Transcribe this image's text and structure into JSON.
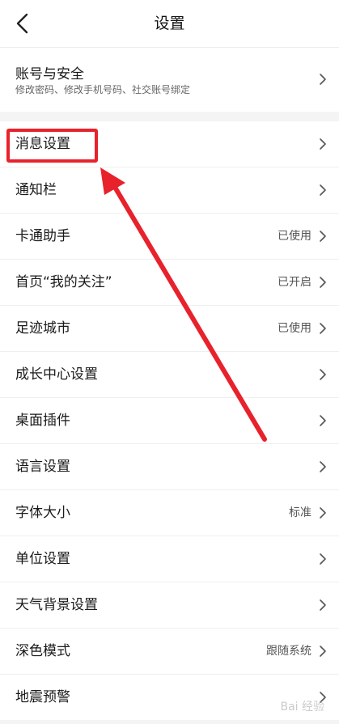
{
  "header": {
    "title": "设置",
    "back_icon": "chevron-left-icon"
  },
  "account": {
    "title": "账号与安全",
    "subtitle": "修改密码、修改手机号码、社交账号绑定",
    "chevron_icon": "chevron-right-icon"
  },
  "settings": {
    "items": [
      {
        "label": "消息设置",
        "value": ""
      },
      {
        "label": "通知栏",
        "value": ""
      },
      {
        "label": "卡通助手",
        "value": "已使用"
      },
      {
        "label": "首页“我的关注”",
        "value": "已开启"
      },
      {
        "label": "足迹城市",
        "value": "已使用"
      },
      {
        "label": "成长中心设置",
        "value": ""
      },
      {
        "label": "桌面插件",
        "value": ""
      },
      {
        "label": "语言设置",
        "value": ""
      },
      {
        "label": "字体大小",
        "value": "标准"
      },
      {
        "label": "单位设置",
        "value": ""
      },
      {
        "label": "天气背景设置",
        "value": ""
      },
      {
        "label": "深色模式",
        "value": "跟随系统"
      },
      {
        "label": "地震预警",
        "value": ""
      }
    ]
  },
  "annotation": {
    "highlight_color": "#e8222c"
  },
  "watermark": {
    "text": "Bai 经验"
  },
  "colors": {
    "background": "#f4f4f4",
    "card": "#ffffff",
    "text_primary": "#1a1a1a",
    "text_secondary": "#555555",
    "chevron": "#555555"
  }
}
